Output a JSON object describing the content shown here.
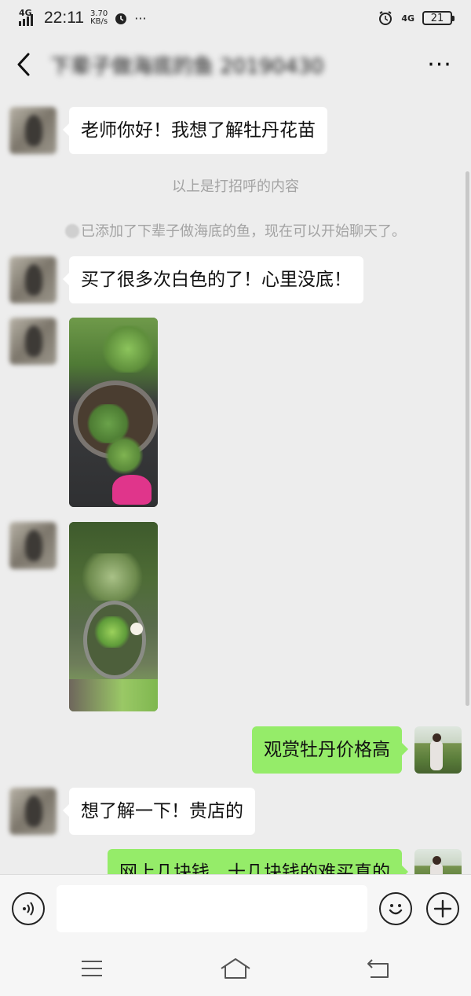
{
  "status_bar": {
    "network": "4G",
    "time": "22:11",
    "speed_value": "3.70",
    "speed_unit": "KB/s",
    "more": "···",
    "right_network": "4G",
    "battery": "21"
  },
  "title_bar": {
    "title": "下辈子做海底的鱼 20190430",
    "more_label": "···"
  },
  "messages": {
    "m1": "老师你好！我想了解牡丹花苗",
    "sys1": "以上是打招呼的内容",
    "sys2": "已添加了下辈子做海底的鱼，现在可以开始聊天了。",
    "m2": "买了很多次白色的了！心里没底！",
    "m3": "观赏牡丹价格高",
    "m4": "想了解一下！贵店的",
    "m5": "网上几块钱，十几块钱的难买真的"
  },
  "input": {
    "placeholder": ""
  },
  "colors": {
    "background": "#ededed",
    "self_bubble": "#95ec69",
    "other_bubble": "#ffffff"
  },
  "icons": {
    "back": "chevron-left-icon",
    "more": "more-dots-icon",
    "voice": "voice-icon",
    "emoji": "emoji-icon",
    "add": "plus-icon",
    "nav_menu": "menu-icon",
    "nav_home": "home-icon",
    "nav_back": "back-nav-icon"
  }
}
